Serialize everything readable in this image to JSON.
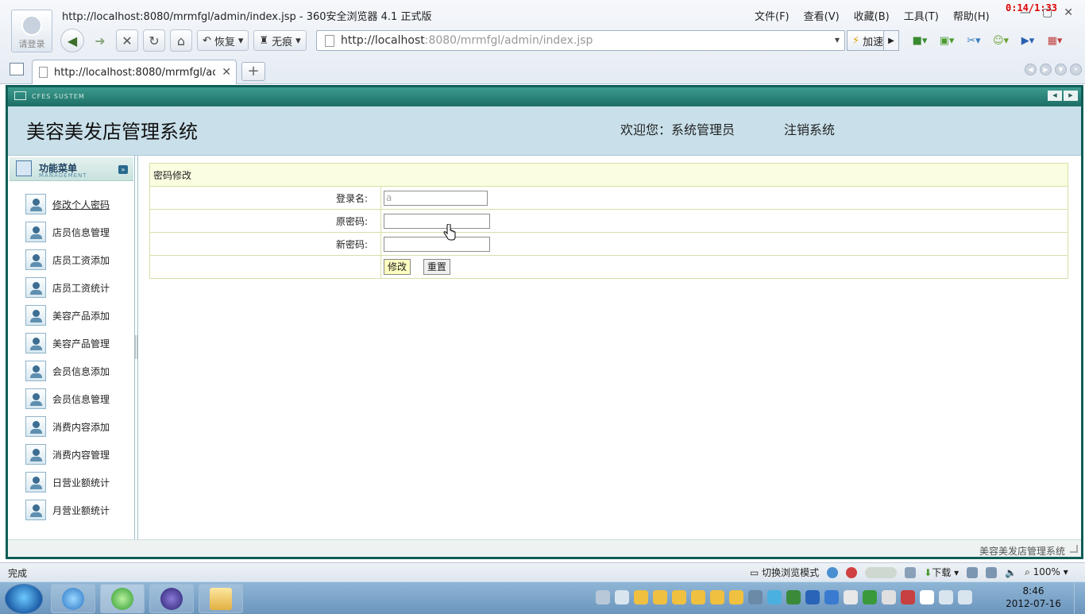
{
  "browser": {
    "avatar_label": "请登录",
    "title": "http://localhost:8080/mrmfgl/admin/index.jsp - 360安全浏览器 4.1 正式版",
    "menu": [
      "文件(F)",
      "查看(V)",
      "收藏(B)",
      "工具(T)",
      "帮助(H)"
    ],
    "timer": "0:14/1:33",
    "restore_label": "恢复",
    "incognito_label": "无痕",
    "url_host": "http://localhost",
    "url_rest": ":8080/mrmfgl/admin/index.jsp",
    "speedup_label": "加速",
    "tab_title": "http://localhost:8080/mrmfgl/adm...",
    "status": "完成",
    "status_mode": "切换浏览模式",
    "download_label": "下载",
    "zoom": "100%"
  },
  "app": {
    "strip_label": "CFES SUSTEM",
    "title": "美容美发店管理系统",
    "welcome": "欢迎您：系统管理员",
    "logout": "注销系统",
    "menu_title": "功能菜单",
    "menu_subtitle": "MANAGEMENT",
    "menu_items": [
      "修改个人密码",
      "店员信息管理",
      "店员工资添加",
      "店员工资统计",
      "美容产品添加",
      "美容产品管理",
      "会员信息添加",
      "会员信息管理",
      "消费内容添加",
      "消费内容管理",
      "日营业额统计",
      "月营业额统计"
    ],
    "footer": "美容美发店管理系统"
  },
  "form": {
    "caption": "密码修改",
    "login_label": "登录名:",
    "login_value": "a",
    "old_pw_label": "原密码:",
    "new_pw_label": "新密码:",
    "submit_label": "修改",
    "reset_label": "重置"
  },
  "taskbar": {
    "time": "8:46",
    "date": "2012-07-16"
  }
}
